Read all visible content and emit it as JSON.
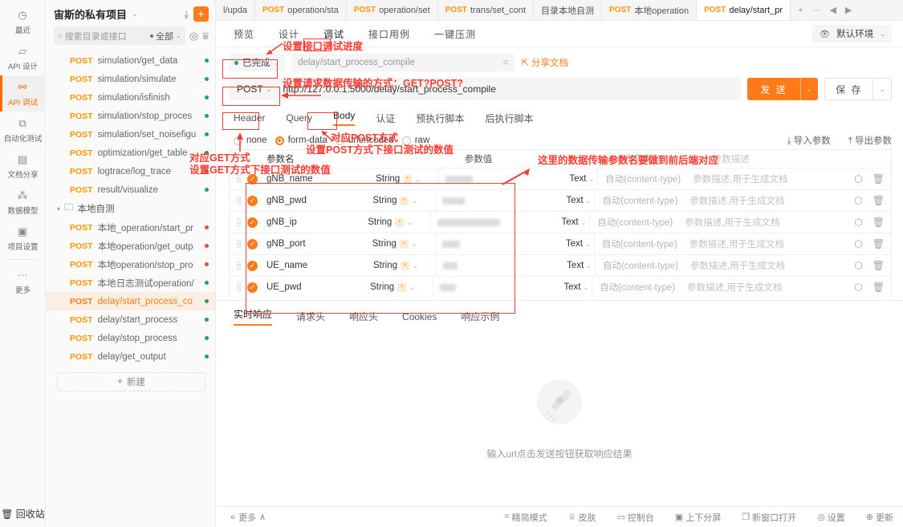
{
  "rail": {
    "items": [
      {
        "icon": "history-icon",
        "glyph": "◷",
        "label": "最近"
      },
      {
        "icon": "design-icon",
        "glyph": "▱",
        "label": "API 设计"
      },
      {
        "icon": "debug-icon",
        "glyph": "⚯",
        "label": "API 调试"
      },
      {
        "icon": "automation-icon",
        "glyph": "⧉",
        "label": "自动化测试"
      },
      {
        "icon": "doc-share-icon",
        "glyph": "▤",
        "label": "文档分享"
      },
      {
        "icon": "data-model-icon",
        "glyph": "⁂",
        "label": "数据模型"
      },
      {
        "icon": "project-settings-icon",
        "glyph": "▣",
        "label": "项目设置"
      },
      {
        "icon": "more-icon",
        "glyph": "···",
        "label": "更多"
      }
    ],
    "active_index": 2,
    "bottom": {
      "icon": "trash-icon",
      "glyph": "🗑",
      "label": "回收站"
    }
  },
  "explorer": {
    "project_title": "宙斯的私有项目",
    "upload_icon": "upload-icon",
    "add_label": "+",
    "search": {
      "placeholder": "搜索目录或接口",
      "scope_label": "全部"
    },
    "filter_icon": "target-icon",
    "sort_icon": "sort-icon",
    "items": [
      {
        "method": "POST",
        "name": "simulation/get_data",
        "status": "green"
      },
      {
        "method": "POST",
        "name": "simulation/simulate",
        "status": "green"
      },
      {
        "method": "POST",
        "name": "simulation/isfinish",
        "status": "green"
      },
      {
        "method": "POST",
        "name": "simulation/stop_proces",
        "status": "green"
      },
      {
        "method": "POST",
        "name": "simulation/set_noisefigu",
        "status": "green"
      },
      {
        "method": "POST",
        "name": "optimization/get_table",
        "status": "green"
      },
      {
        "method": "POST",
        "name": "logtrace/log_trace",
        "status": "green"
      },
      {
        "method": "POST",
        "name": "result/visualize",
        "status": "green"
      }
    ],
    "folder": {
      "label": "本地自测",
      "folder_icon": "folder-icon",
      "twisty": "▾"
    },
    "folder_items": [
      {
        "method": "POST",
        "name": "本地_operation/start_pr",
        "status": "red"
      },
      {
        "method": "POST",
        "name": "本地operation/get_outp",
        "status": "red"
      },
      {
        "method": "POST",
        "name": "本地operation/stop_pro",
        "status": "red"
      },
      {
        "method": "POST",
        "name": "本地日志测试operation/",
        "status": "green"
      },
      {
        "method": "POST",
        "name": "delay/start_process_co",
        "status": "green",
        "selected": true
      },
      {
        "method": "POST",
        "name": "delay/start_process",
        "status": "green"
      },
      {
        "method": "POST",
        "name": "delay/stop_process",
        "status": "green"
      },
      {
        "method": "POST",
        "name": "delay/get_output",
        "status": "green"
      }
    ],
    "new_button": "新建"
  },
  "tabbar": {
    "tabs": [
      {
        "method": "",
        "label": "l/upda"
      },
      {
        "method": "POST",
        "label": "operation/sta"
      },
      {
        "method": "POST",
        "label": "operation/set"
      },
      {
        "method": "POST",
        "label": "trans/set_cont"
      },
      {
        "method": "",
        "label": "目录本地自测"
      },
      {
        "method": "POST",
        "label": "本地operation"
      },
      {
        "method": "POST",
        "label": "delay/start_pr",
        "active": true
      }
    ],
    "tools": [
      {
        "name": "new-tab-icon",
        "glyph": "+"
      },
      {
        "name": "tab-menu-icon",
        "glyph": "···"
      },
      {
        "name": "tab-prev-icon",
        "glyph": "◀"
      },
      {
        "name": "tab-next-icon",
        "glyph": "▶"
      }
    ]
  },
  "subtabs": {
    "items": [
      "预览",
      "设计",
      "调试",
      "接口用例",
      "一键压测"
    ],
    "active": "调试",
    "env": {
      "eye_icon": "eye-icon",
      "label": "默认环境",
      "caret": "⌄"
    }
  },
  "request": {
    "status": {
      "label": "已完成",
      "caret": "⌄"
    },
    "name_value": "delay/start_process_compile",
    "name_icon": "format-icon",
    "share_doc": "分享文档",
    "method": "POST",
    "method_caret": "⌄",
    "url": "http://127.0.0.1:5000/delay/start_process_compile",
    "send_label": "发 送",
    "save_label": "保 存",
    "tabs": [
      "Header",
      "Query",
      "Body",
      "认证",
      "预执行脚本",
      "后执行脚本"
    ],
    "active_tab": "Body",
    "body_types": [
      {
        "label": "none",
        "on": false
      },
      {
        "label": "form-data",
        "on": true
      },
      {
        "label": "urlencoded",
        "on": false
      },
      {
        "label": "raw",
        "on": false
      }
    ],
    "import_label": "导入参数",
    "export_label": "导出参数",
    "import_icon": "import-icon",
    "export_icon": "export-icon"
  },
  "table": {
    "headers": {
      "name": "参数名",
      "value": "参数值",
      "content_type": "内容类型",
      "description": "参数描述"
    },
    "value_type_label": "Text",
    "rows": [
      {
        "name": "gNB_name",
        "type": "String",
        "required": "*",
        "value_masked": true,
        "value_width": 34,
        "value_label": "Text",
        "content_type": "自动(content-type)",
        "description": "参数描述,用于生成文档"
      },
      {
        "name": "gNB_pwd",
        "type": "String",
        "required": "*",
        "value_masked": true,
        "value_width": 28,
        "value_label": "Text",
        "content_type": "自动(content-type)",
        "description": "参数描述,用于生成文档"
      },
      {
        "name": "gNB_ip",
        "type": "String",
        "required": "*",
        "value_masked": true,
        "value_width": 78,
        "value_label": "Text",
        "content_type": "自动(content-type)",
        "description": "参数描述,用于生成文档"
      },
      {
        "name": "gNB_port",
        "type": "String",
        "required": "*",
        "value_masked": true,
        "value_width": 22,
        "value_label": "Text",
        "content_type": "自动(content-type)",
        "description": "参数描述,用于生成文档"
      },
      {
        "name": "UE_name",
        "type": "String",
        "required": "*",
        "value_masked": true,
        "value_width": 18,
        "value_label": "Text",
        "content_type": "自动(content-type)",
        "description": "参数描述,用于生成文档"
      },
      {
        "name": "UE_pwd",
        "type": "String",
        "required": "*",
        "value_masked": true,
        "value_width": 20,
        "value_label": "Text",
        "content_type": "自动(content-type)",
        "description": "参数描述,用于生成文档"
      }
    ],
    "row_actions": [
      {
        "name": "mock-icon",
        "glyph": "⬡"
      },
      {
        "name": "delete-row-icon",
        "glyph": "🗑"
      }
    ]
  },
  "response": {
    "tabs": [
      "实时响应",
      "请求头",
      "响应头",
      "Cookies",
      "响应示例"
    ],
    "active": "实时响应",
    "empty_icon": "rocket-icon",
    "empty_hint": "输入url点击发送按钮获取响应结果"
  },
  "footer": {
    "more_label": "更多",
    "more_caret": "∧",
    "collapse_icon": "collapse-icon",
    "right_items": [
      {
        "icon": "compact-mode-icon",
        "glyph": "⌗",
        "label": "精简模式"
      },
      {
        "icon": "skin-icon",
        "glyph": "♕",
        "label": "皮肤"
      },
      {
        "icon": "console-icon",
        "glyph": "▭",
        "label": "控制台"
      },
      {
        "icon": "split-screen-icon",
        "glyph": "▣",
        "label": "上下分屏"
      },
      {
        "icon": "new-window-icon",
        "glyph": "❐",
        "label": "新窗口打开"
      },
      {
        "icon": "settings-icon",
        "glyph": "◎",
        "label": "设置"
      },
      {
        "icon": "update-icon",
        "glyph": "⊕",
        "label": "更新"
      }
    ]
  },
  "annotations": {
    "debug_progress": "设置接口调试进度",
    "transfer_method": "设置请求数据传输的方式：GET?POST?",
    "get_line1": "对应GET方式",
    "get_line2": "设置GET方式下接口测试的数值",
    "post_line1": "对应POST方式",
    "post_line2": "设置POST方式下接口测试的数值",
    "param_name_note": "这里的数据传输参数名要做到前后端对应"
  },
  "colors": {
    "accent": "#ff7a18",
    "method": "#ff9500",
    "annotation": "#ff3b30",
    "status_green": "#22a06b",
    "status_red": "#e74c3c"
  }
}
